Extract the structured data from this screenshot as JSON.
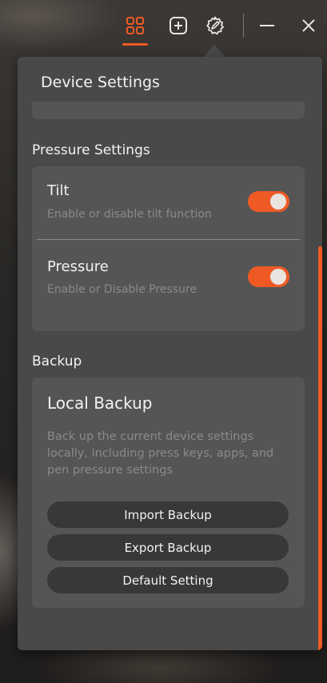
{
  "titlebar": {
    "buttons": [
      {
        "name": "grid-icon",
        "active": true
      },
      {
        "name": "add-square-icon",
        "active": false
      },
      {
        "name": "settings-pen-icon",
        "active": false
      },
      {
        "name": "minimize-icon",
        "active": false
      },
      {
        "name": "close-icon",
        "active": false
      }
    ]
  },
  "panel": {
    "title": "Device Settings"
  },
  "pressure_settings": {
    "heading": "Pressure Settings",
    "items": [
      {
        "title": "Tilt",
        "description": "Enable or disable tilt function",
        "enabled": true
      },
      {
        "title": "Pressure",
        "description": "Enable or Disable Pressure",
        "enabled": true
      }
    ]
  },
  "backup": {
    "heading": "Backup",
    "card_title": "Local Backup",
    "description": "Back up the current device settings locally, including press keys, apps, and pen pressure settings",
    "buttons": {
      "import": "Import Backup",
      "export": "Export Backup",
      "default": "Default Setting"
    }
  },
  "colors": {
    "accent": "#ef5a24",
    "panel_bg": "#494949",
    "card_bg": "#555555",
    "button_bg": "#383838",
    "muted_text": "#8a8a8a"
  }
}
